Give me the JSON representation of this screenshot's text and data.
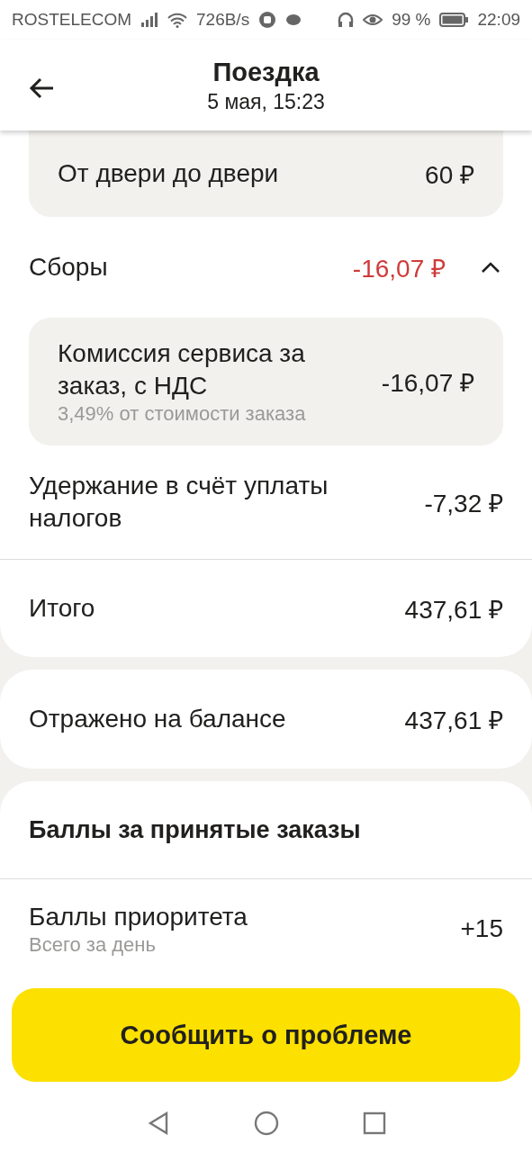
{
  "status_bar": {
    "carrier": "ROSTELECOM",
    "speed": "726B/s",
    "battery": "99 %",
    "time": "22:09"
  },
  "header": {
    "title": "Поездка",
    "subtitle": "5 мая, 15:23"
  },
  "door_card": {
    "label": "От двери до двери",
    "amount": "60 ₽"
  },
  "fees": {
    "label": "Сборы",
    "amount": "-16,07 ₽",
    "expanded": true,
    "items": [
      {
        "label": "Комиссия сервиса за заказ, с НДС",
        "note": "3,49% от стоимости заказа",
        "amount": "-16,07 ₽"
      }
    ]
  },
  "tax": {
    "label": "Удержание в счёт уплаты налогов",
    "amount": "-7,32 ₽"
  },
  "total": {
    "label": "Итого",
    "amount": "437,61 ₽"
  },
  "balance": {
    "label": "Отражено на балансе",
    "amount": "437,61 ₽"
  },
  "points": {
    "title": "Баллы за принятые заказы",
    "rows": [
      {
        "label": "Баллы приоритета",
        "note": "Всего за день",
        "amount": "+15"
      }
    ]
  },
  "action_button": "Сообщить о проблеме"
}
